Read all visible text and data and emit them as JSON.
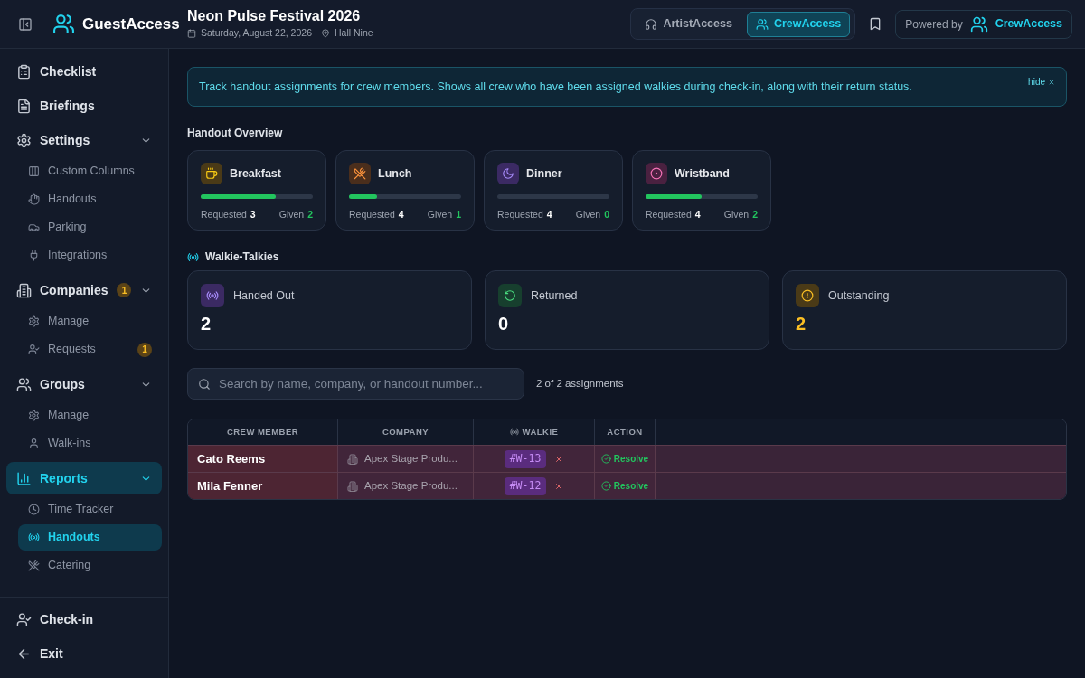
{
  "header": {
    "brand": "GuestAccess",
    "event": {
      "title": "Neon Pulse Festival 2026",
      "date": "Saturday, August 22, 2026",
      "venue": "Hall Nine"
    },
    "app_switch": [
      {
        "label": "ArtistAccess",
        "selected": false
      },
      {
        "label": "CrewAccess",
        "selected": true
      }
    ],
    "powered_by": {
      "label": "Powered by",
      "product": "CrewAccess"
    }
  },
  "sidebar": {
    "items": [
      {
        "label": "Checklist",
        "selected": false
      },
      {
        "label": "Briefings",
        "selected": false
      },
      {
        "label": "Settings",
        "selected": false,
        "expanded": true,
        "children": [
          {
            "label": "Custom Columns",
            "selected": false
          },
          {
            "label": "Handouts",
            "selected": false
          },
          {
            "label": "Parking",
            "selected": false
          },
          {
            "label": "Integrations",
            "selected": false
          }
        ]
      },
      {
        "label": "Companies",
        "selected": false,
        "badge": "1",
        "expanded": true,
        "children": [
          {
            "label": "Manage",
            "selected": false
          },
          {
            "label": "Requests",
            "selected": false,
            "badge": "1"
          }
        ]
      },
      {
        "label": "Groups",
        "selected": false,
        "expanded": true,
        "children": [
          {
            "label": "Manage",
            "selected": false
          },
          {
            "label": "Walk-ins",
            "selected": false
          }
        ]
      },
      {
        "label": "Reports",
        "selected": true,
        "expanded": true,
        "children": [
          {
            "label": "Time Tracker",
            "selected": false
          },
          {
            "label": "Handouts",
            "selected": true
          },
          {
            "label": "Catering",
            "selected": false
          }
        ]
      }
    ],
    "footer_items": [
      {
        "label": "Check-in"
      },
      {
        "label": "Exit"
      }
    ]
  },
  "info_banner": {
    "text": "Track handout assignments for crew members. Shows all crew who have been assigned walkies during check-in, along with their return status.",
    "dismiss": "hide"
  },
  "handout_overview": {
    "title": "Handout Overview",
    "items": [
      {
        "name": "Breakfast",
        "level": 0.67,
        "requested_label": "Requested",
        "requested": "3",
        "given_label": "Given",
        "given": "2"
      },
      {
        "name": "Lunch",
        "level": 0.25,
        "requested_label": "Requested",
        "requested": "4",
        "given_label": "Given",
        "given": "1"
      },
      {
        "name": "Dinner",
        "requested_label": "Requested",
        "requested": "4",
        "given_label": "Given",
        "given": "0"
      },
      {
        "name": "Wristband",
        "level": 0.5,
        "requested_label": "Requested",
        "requested": "4",
        "given_label": "Given",
        "given": "2"
      }
    ]
  },
  "walkie_talkies": {
    "title": "Walkie-Talkies",
    "stats": [
      {
        "kind": "neutral",
        "label": "Handed Out",
        "value": "2"
      },
      {
        "kind": "success",
        "label": "Returned",
        "value": "0"
      },
      {
        "kind": "warning",
        "label": "Outstanding",
        "value": "2"
      }
    ]
  },
  "search": {
    "placeholder": "Search by name, company, or handout number...",
    "result_count": "2 of 2 assignments"
  },
  "table": {
    "columns": [
      "CREW MEMBER",
      "COMPANY",
      "WALKIE",
      "ACTION"
    ],
    "rows": [
      {
        "crew_member": "Cato Reems",
        "company": "Apex Stage Produ...",
        "walkie": "#W-13",
        "action": "Resolve",
        "outstanding": true
      },
      {
        "crew_member": "Mila Fenner",
        "company": "Apex Stage Produ...",
        "walkie": "#W-12",
        "action": "Resolve",
        "outstanding": true
      }
    ]
  }
}
